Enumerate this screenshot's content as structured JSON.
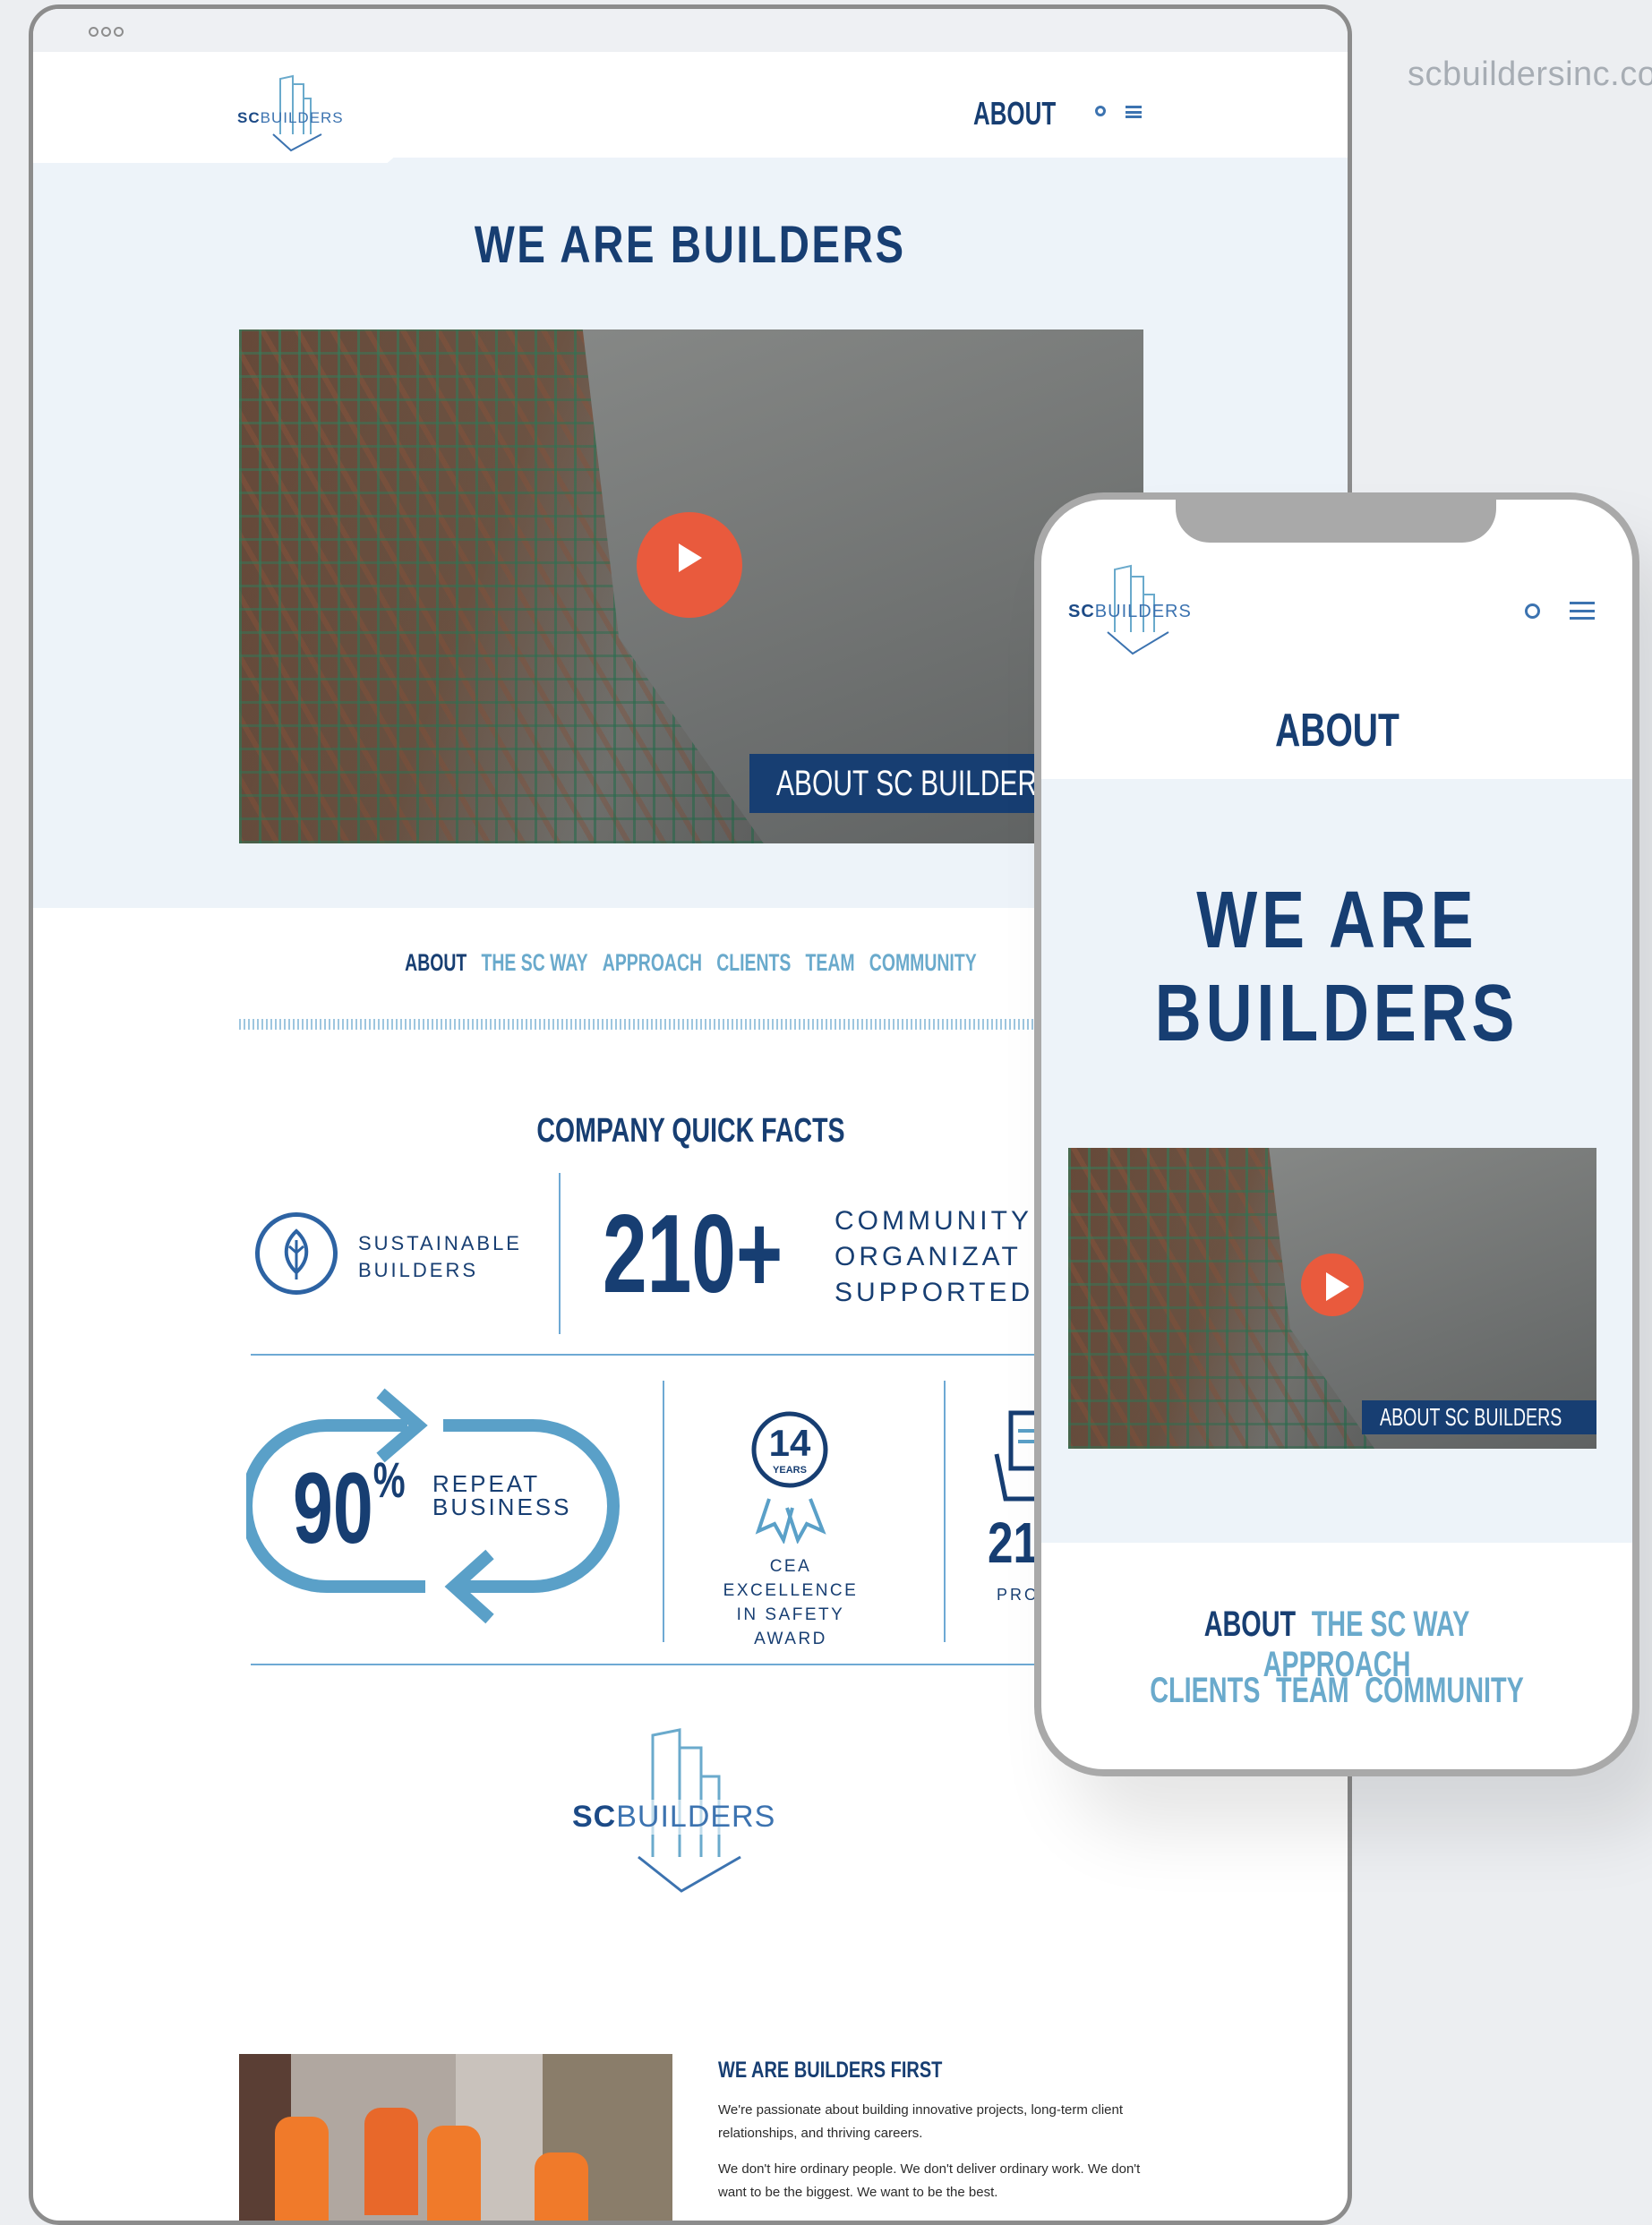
{
  "domain_url": "scbuildersinc.co",
  "brand": {
    "sc": "SC",
    "builders": "BUILDERS"
  },
  "colors": {
    "navy": "#173e72",
    "light_blue": "#6aaacc",
    "play_orange": "#e95a3d",
    "hero_bg": "#edf3f9"
  },
  "desktop": {
    "nav_about": "ABOUT",
    "hero_title": "WE ARE BUILDERS",
    "video_caption": "ABOUT SC BUILDERS",
    "tabs": [
      {
        "label": "ABOUT",
        "active": true
      },
      {
        "label": "THE SC WAY",
        "active": false
      },
      {
        "label": "APPROACH",
        "active": false
      },
      {
        "label": "CLIENTS",
        "active": false
      },
      {
        "label": "TEAM",
        "active": false
      },
      {
        "label": "COMMUNITY",
        "active": false
      }
    ],
    "facts_title": "COMPANY QUICK FACTS",
    "facts": {
      "sustainable_line1": "SUSTAINABLE",
      "sustainable_line2": "BUILDERS",
      "community_number": "210+",
      "community_line1": "COMMUNITY",
      "community_line2": "ORGANIZAT",
      "community_line3": "SUPPORTED",
      "repeat_number": "90",
      "repeat_percent": "%",
      "repeat_line1": "REPEAT",
      "repeat_line2": "BUSINESS",
      "safety_years": "14",
      "safety_years_label": "YEARS",
      "safety_line1": "CEA EXCELLENCE",
      "safety_line2": "IN SAFETY AWARD",
      "partial_number": "21",
      "partial_label": "PRO"
    },
    "article": {
      "title": "WE ARE BUILDERS FIRST",
      "para1": "We're passionate about building innovative projects, long-term client relationships, and thriving careers.",
      "para2": "We don't hire ordinary people. We don't deliver ordinary work. We don't want to be the biggest. We want to be the best."
    }
  },
  "mobile": {
    "page_label": "ABOUT",
    "hero_title_line1": "WE ARE",
    "hero_title_line2": "BUILDERS",
    "video_caption": "ABOUT SC BUILDERS",
    "tabs_row1": [
      {
        "label": "ABOUT",
        "active": true
      },
      {
        "label": "THE SC WAY",
        "active": false
      },
      {
        "label": "APPROACH",
        "active": false
      }
    ],
    "tabs_row2": [
      {
        "label": "CLIENTS",
        "active": false
      },
      {
        "label": "TEAM",
        "active": false
      },
      {
        "label": "COMMUNITY",
        "active": false
      }
    ]
  }
}
